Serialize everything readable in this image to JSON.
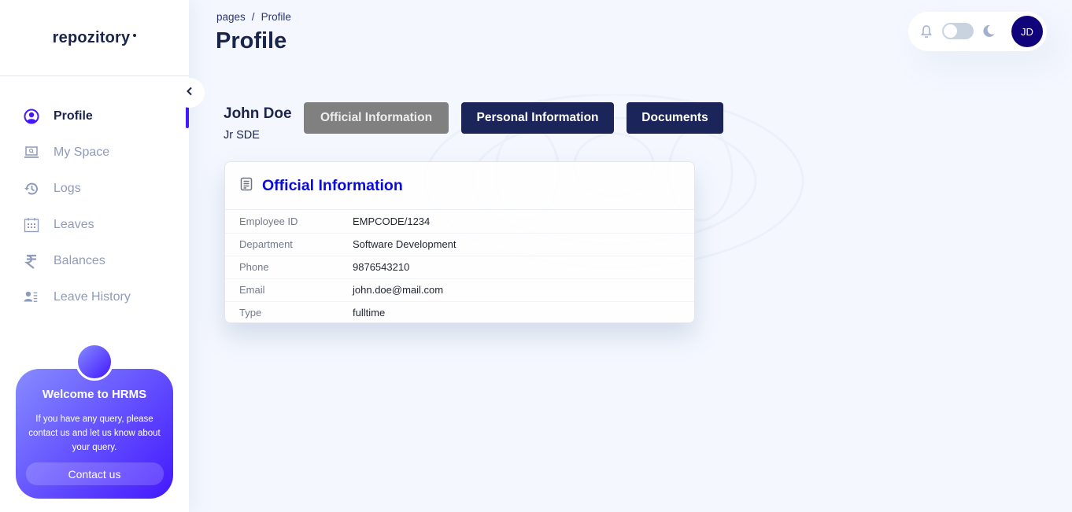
{
  "brand": {
    "name": "repozitory"
  },
  "sidebar": {
    "items": [
      {
        "label": "Profile",
        "icon": "user-circle-icon",
        "active": true
      },
      {
        "label": "My Space",
        "icon": "laptop-search-icon",
        "active": false
      },
      {
        "label": "Logs",
        "icon": "history-icon",
        "active": false
      },
      {
        "label": "Leaves",
        "icon": "calendar-icon",
        "active": false
      },
      {
        "label": "Balances",
        "icon": "rupee-icon",
        "active": false
      },
      {
        "label": "Leave History",
        "icon": "user-list-icon",
        "active": false
      }
    ],
    "promo": {
      "title": "Welcome to HRMS",
      "text": "If you have any query, please contact us and let us know about your query.",
      "button": "Contact us"
    }
  },
  "header": {
    "breadcrumb": {
      "root": "pages",
      "separator": "/",
      "current": "Profile"
    },
    "title": "Profile",
    "user_initials": "JD",
    "dark_mode": false
  },
  "profile": {
    "name": "John Doe",
    "role": "Jr SDE",
    "tabs": [
      {
        "label": "Official Information",
        "active": true
      },
      {
        "label": "Personal Information",
        "active": false
      },
      {
        "label": "Documents",
        "active": false
      }
    ]
  },
  "card": {
    "title": "Official Information",
    "rows": [
      {
        "key": "Employee ID",
        "value": "EMPCODE/1234"
      },
      {
        "key": "Department",
        "value": "Software Development"
      },
      {
        "key": "Phone",
        "value": "9876543210"
      },
      {
        "key": "Email",
        "value": "john.doe@mail.com"
      },
      {
        "key": "Type",
        "value": "fulltime"
      }
    ]
  },
  "colors": {
    "accent": "#4318ff",
    "navy": "#1b2559",
    "avatar": "#11047a",
    "card_title": "#0b0bd6",
    "tab_active": "#808080"
  }
}
